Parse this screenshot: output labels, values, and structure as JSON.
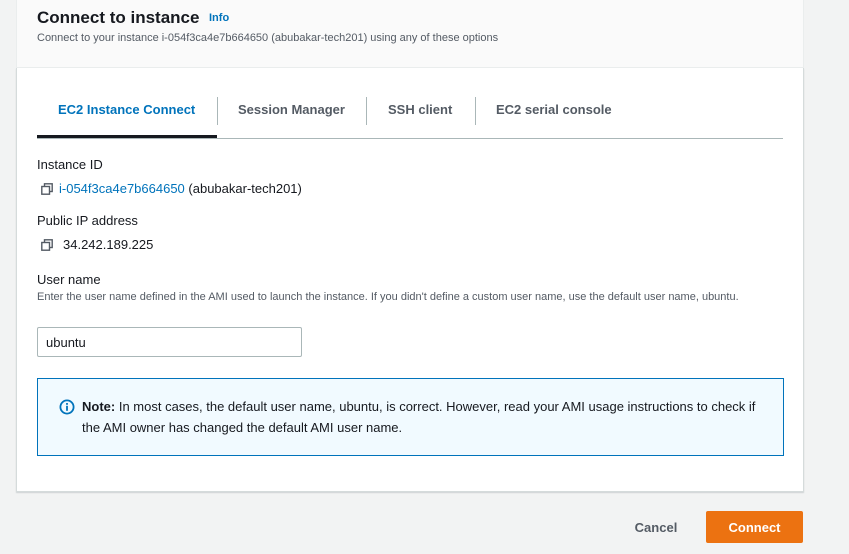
{
  "header": {
    "title": "Connect to instance",
    "info_label": "Info",
    "description": "Connect to your instance i-054f3ca4e7b664650 (abubakar-tech201) using any of these options"
  },
  "tabs": [
    {
      "label": "EC2 Instance Connect",
      "active": true
    },
    {
      "label": "Session Manager",
      "active": false
    },
    {
      "label": "SSH client",
      "active": false
    },
    {
      "label": "EC2 serial console",
      "active": false
    }
  ],
  "instance": {
    "id_label": "Instance ID",
    "id_value": "i-054f3ca4e7b664650",
    "name_value": "(abubakar-tech201)",
    "ip_label": "Public IP address",
    "ip_value": "34.242.189.225"
  },
  "username": {
    "label": "User name",
    "hint": "Enter the user name defined in the AMI used to launch the instance. If you didn't define a custom user name, use the default user name, ubuntu.",
    "value": "ubuntu"
  },
  "note": {
    "prefix": "Note:",
    "text": " In most cases, the default user name, ubuntu, is correct. However, read your AMI usage instructions to check if the AMI owner has changed the default AMI user name."
  },
  "footer": {
    "cancel_label": "Cancel",
    "connect_label": "Connect"
  },
  "colors": {
    "accent": "#0073bb",
    "primary_button": "#ec7211",
    "alert_bg": "#f1faff"
  }
}
